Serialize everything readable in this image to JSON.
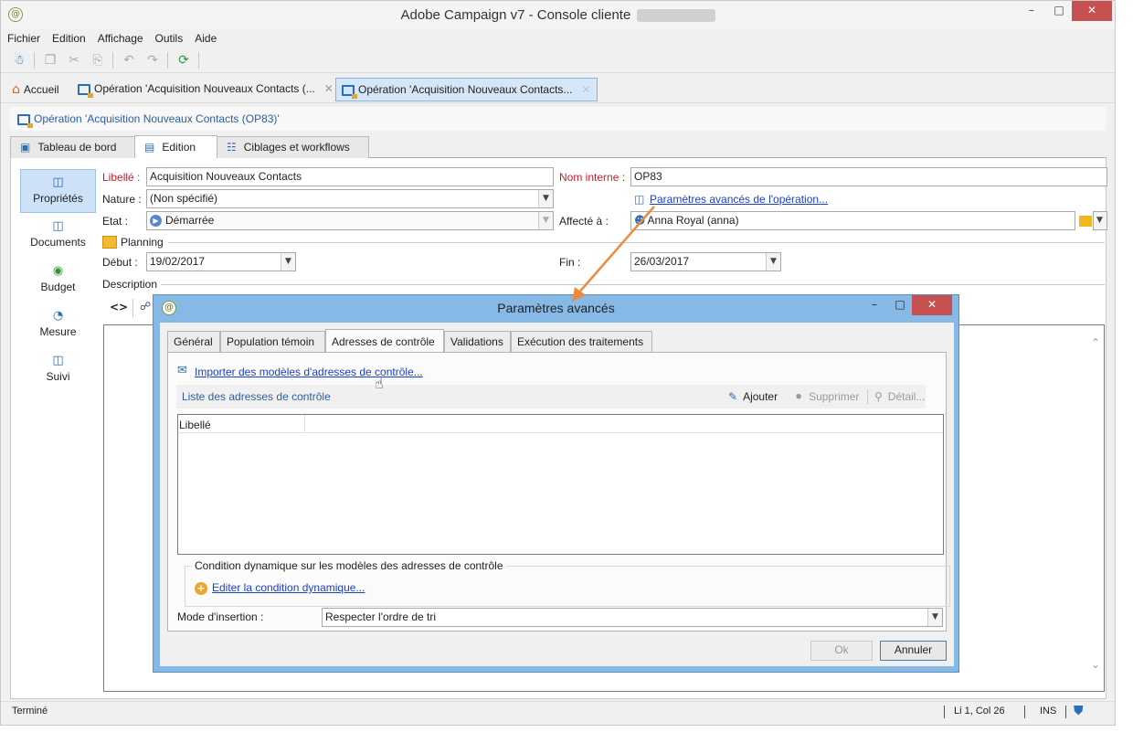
{
  "window": {
    "title": "Adobe Campaign v7 - Console cliente",
    "minimize": "–",
    "maximize": "□",
    "close": "✕"
  },
  "menu": [
    "Fichier",
    "Edition",
    "Affichage",
    "Outils",
    "Aide"
  ],
  "toolbar": {
    "icons": [
      "add-user-icon",
      "copy-icon",
      "cut-icon",
      "paste-icon",
      "undo-icon",
      "redo-icon",
      "refresh-icon"
    ]
  },
  "doc_tabs": [
    {
      "label": "Accueil",
      "icon": "home-icon"
    },
    {
      "label": "Opération 'Acquisition Nouveaux Contacts (...",
      "icon": "operation-icon"
    },
    {
      "label": "Opération 'Acquisition Nouveaux Contacts...",
      "icon": "operation-icon",
      "active": true
    }
  ],
  "breadcrumb": "Opération 'Acquisition Nouveaux Contacts (OP83)'",
  "section_tabs": [
    "Tableau de bord",
    "Edition",
    "Ciblages et workflows"
  ],
  "sidebar": [
    "Propriétés",
    "Documents",
    "Budget",
    "Mesure",
    "Suivi"
  ],
  "form": {
    "libelle_label": "Libellé :",
    "libelle_value": "Acquisition Nouveaux Contacts",
    "nom_interne_label": "Nom interne :",
    "nom_interne_value": "OP83",
    "nature_label": "Nature :",
    "nature_value": "(Non spécifié)",
    "params_link": "Paramètres avancés de l'opération...",
    "etat_label": "Etat :",
    "etat_value": "Démarrée",
    "affecte_label": "Affecté à :",
    "affecte_value": "Anna Royal (anna)",
    "planning_label": "Planning",
    "debut_label": "Début :",
    "debut_value": "19/02/2017",
    "fin_label": "Fin :",
    "fin_value": "26/03/2017",
    "description_label": "Description"
  },
  "status": {
    "left": "Terminé",
    "position": "Li 1, Col 26",
    "mode": "INS"
  },
  "dialog": {
    "title": "Paramètres avancés",
    "tabs": [
      "Général",
      "Population témoin",
      "Adresses de contrôle",
      "Validations",
      "Exécution des traitements"
    ],
    "active_tab": "Adresses de contrôle",
    "import_link": "Importer des modèles d'adresses de contrôle...",
    "list_title": "Liste des adresses de contrôle",
    "add_label": "Ajouter",
    "delete_label": "Supprimer",
    "detail_label": "Détail...",
    "column_header": "Libellé",
    "group_title": "Condition dynamique sur les modèles des adresses de contrôle",
    "edit_condition_link": "Editer la condition dynamique...",
    "mode_label": "Mode d'insertion :",
    "mode_value": "Respecter l'ordre de tri",
    "ok_label": "Ok",
    "cancel_label": "Annuler"
  },
  "colors": {
    "accent_blue": "#2a6fb5",
    "required_red": "#c8202a",
    "link_blue": "#1a3fc8",
    "dialog_frame": "#86b9e6",
    "arrow_orange": "#ee8a3c"
  }
}
